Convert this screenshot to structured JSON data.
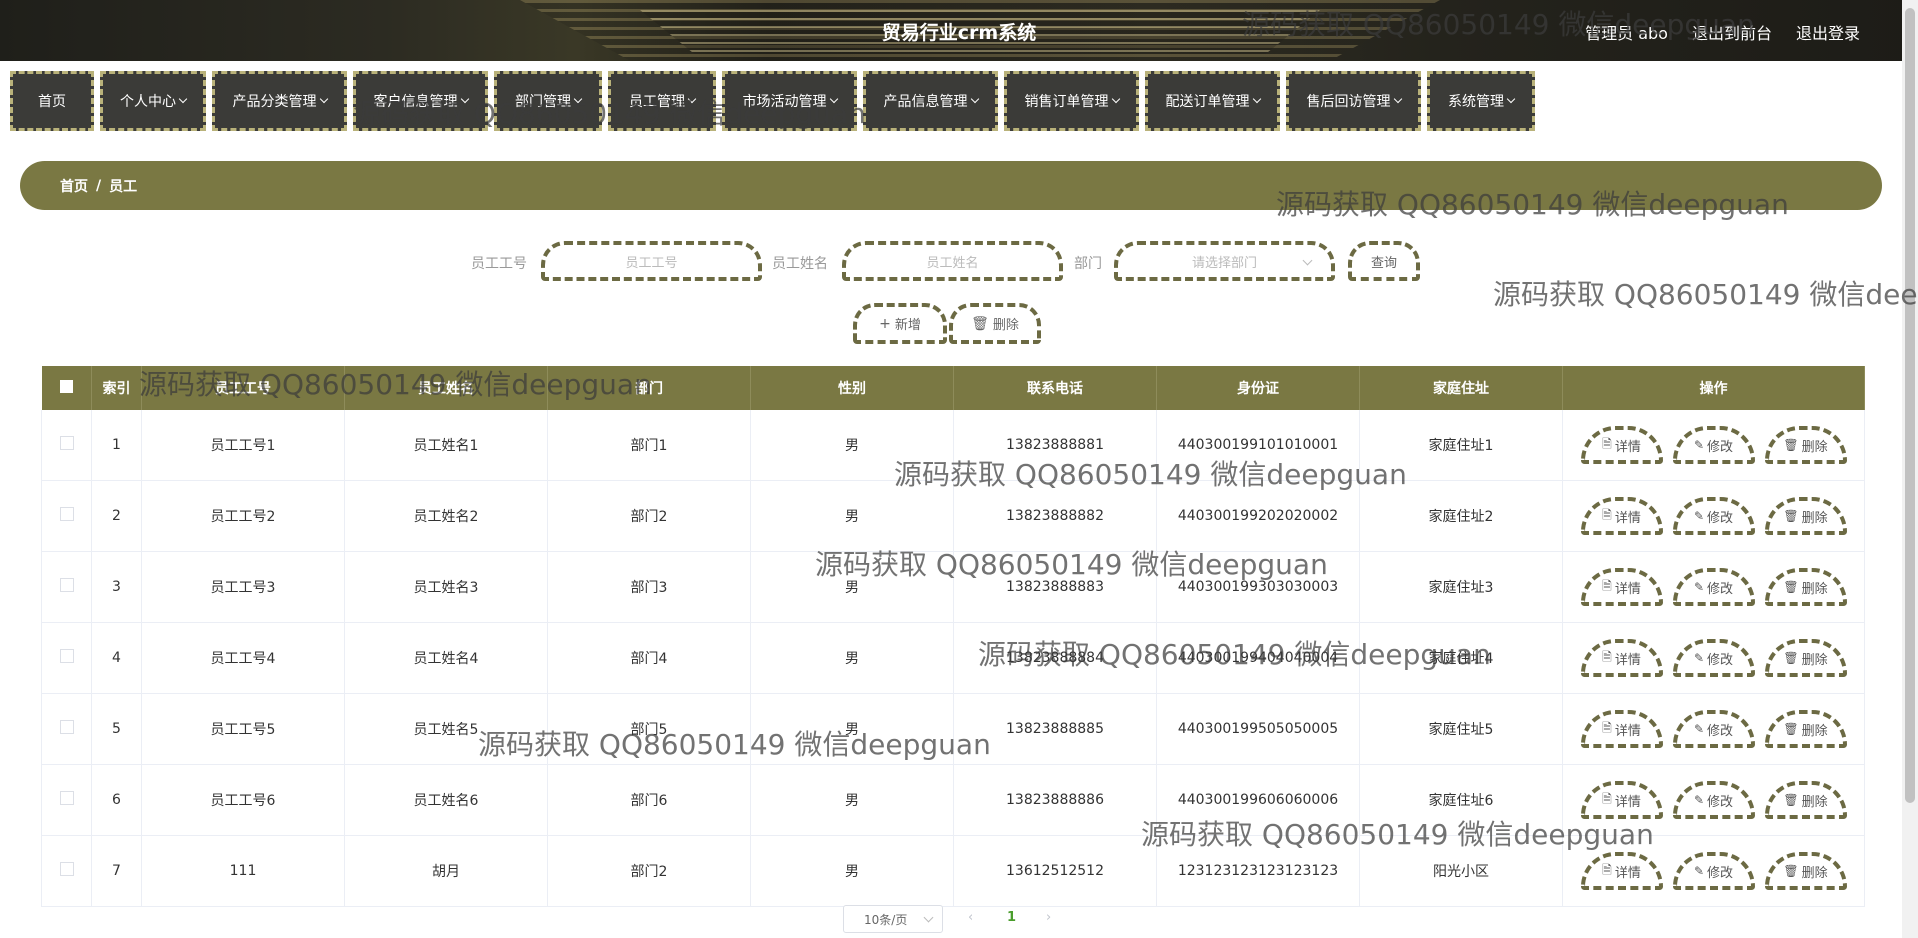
{
  "header": {
    "title": "贸易行业crm系统",
    "admin_label": "管理员 abo",
    "to_front_label": "退出到前台",
    "logout_label": "退出登录"
  },
  "nav": {
    "items": [
      {
        "label": "首页",
        "dropdown": false
      },
      {
        "label": "个人中心",
        "dropdown": true
      },
      {
        "label": "产品分类管理",
        "dropdown": true
      },
      {
        "label": "客户信息管理",
        "dropdown": true
      },
      {
        "label": "部门管理",
        "dropdown": true
      },
      {
        "label": "员工管理",
        "dropdown": true
      },
      {
        "label": "市场活动管理",
        "dropdown": true
      },
      {
        "label": "产品信息管理",
        "dropdown": true
      },
      {
        "label": "销售订单管理",
        "dropdown": true
      },
      {
        "label": "配送订单管理",
        "dropdown": true
      },
      {
        "label": "售后回访管理",
        "dropdown": true
      },
      {
        "label": "系统管理",
        "dropdown": true
      }
    ]
  },
  "breadcrumb": {
    "home": "首页",
    "sep": "/",
    "current": "员工"
  },
  "search": {
    "emp_no_label": "员工工号",
    "emp_no_placeholder": "员工工号",
    "emp_name_label": "员工姓名",
    "emp_name_placeholder": "员工姓名",
    "dept_label": "部门",
    "dept_placeholder": "请选择部门",
    "query_label": "查询",
    "add_label": "新增",
    "delete_label": "删除"
  },
  "table": {
    "headers": [
      "索引",
      "员工工号",
      "员工姓名",
      "部门",
      "性别",
      "联系电话",
      "身份证",
      "家庭住址",
      "操作"
    ],
    "rows": [
      {
        "index": "1",
        "emp_no": "员工工号1",
        "name": "员工姓名1",
        "dept": "部门1",
        "gender": "男",
        "phone": "13823888881",
        "id_card": "440300199101010001",
        "address": "家庭住址1"
      },
      {
        "index": "2",
        "emp_no": "员工工号2",
        "name": "员工姓名2",
        "dept": "部门2",
        "gender": "男",
        "phone": "13823888882",
        "id_card": "440300199202020002",
        "address": "家庭住址2"
      },
      {
        "index": "3",
        "emp_no": "员工工号3",
        "name": "员工姓名3",
        "dept": "部门3",
        "gender": "男",
        "phone": "13823888883",
        "id_card": "440300199303030003",
        "address": "家庭住址3"
      },
      {
        "index": "4",
        "emp_no": "员工工号4",
        "name": "员工姓名4",
        "dept": "部门4",
        "gender": "男",
        "phone": "13823888884",
        "id_card": "440300199404040004",
        "address": "家庭住址4"
      },
      {
        "index": "5",
        "emp_no": "员工工号5",
        "name": "员工姓名5",
        "dept": "部门5",
        "gender": "男",
        "phone": "13823888885",
        "id_card": "440300199505050005",
        "address": "家庭住址5"
      },
      {
        "index": "6",
        "emp_no": "员工工号6",
        "name": "员工姓名6",
        "dept": "部门6",
        "gender": "男",
        "phone": "13823888886",
        "id_card": "440300199606060006",
        "address": "家庭住址6"
      },
      {
        "index": "7",
        "emp_no": "111",
        "name": "胡月",
        "dept": "部门2",
        "gender": "男",
        "phone": "13612512512",
        "id_card": "123123123123123123",
        "address": "阳光小区"
      }
    ],
    "ops": {
      "detail": "详情",
      "edit": "修改",
      "delete": "删除"
    }
  },
  "pagination": {
    "page_size": "10条/页",
    "prev": "‹",
    "current": "1",
    "next": "›"
  },
  "watermark": {
    "text": "源码获取 QQ86050149 微信deepguan"
  },
  "colors": {
    "accent": "#7a7843",
    "nav_bg": "#3b3b38",
    "dashed_border": "#6c6a43",
    "page_active": "#4a9d2c"
  }
}
